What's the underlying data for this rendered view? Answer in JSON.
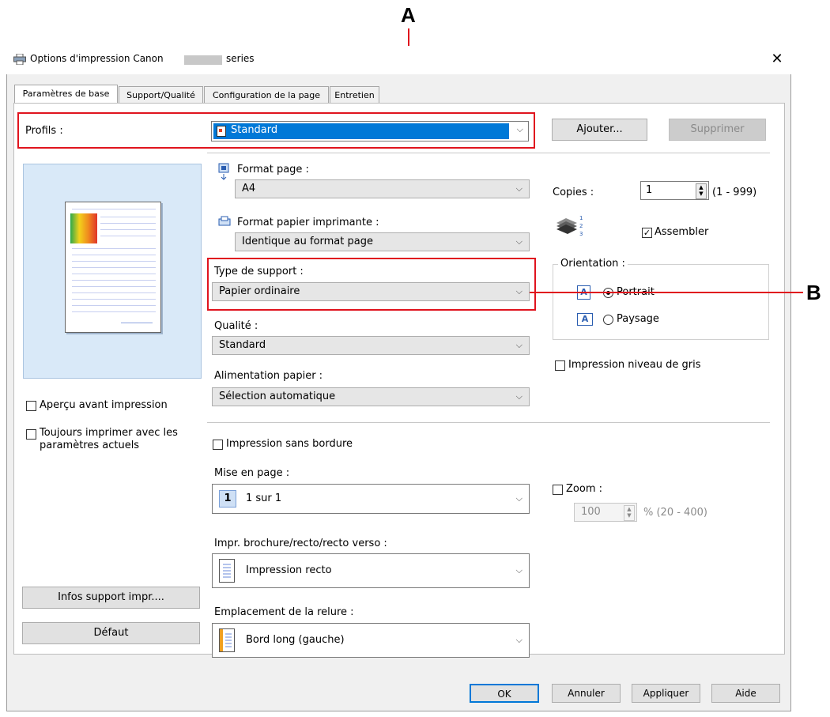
{
  "callouts": {
    "a": "A",
    "b": "B"
  },
  "window": {
    "title": "Options d'impression Canon",
    "title_suffix": "series"
  },
  "tabs": [
    {
      "label": "Paramètres de base"
    },
    {
      "label": "Support/Qualité"
    },
    {
      "label": "Configuration de la page"
    },
    {
      "label": "Entretien"
    }
  ],
  "profiles": {
    "label": "Profils :",
    "value": "Standard",
    "add": "Ajouter...",
    "remove": "Supprimer"
  },
  "page_size": {
    "label": "Format page :",
    "value": "A4"
  },
  "printer_paper": {
    "label": "Format papier imprimante :",
    "value": "Identique au format page"
  },
  "media_type": {
    "label": "Type de support :",
    "value": "Papier ordinaire"
  },
  "quality": {
    "label": "Qualité :",
    "value": "Standard"
  },
  "paper_source": {
    "label": "Alimentation papier :",
    "value": "Sélection automatique"
  },
  "copies": {
    "label": "Copies :",
    "value": "1",
    "range": "(1 - 999)",
    "collate": "Assembler",
    "collate_checked": true
  },
  "orientation": {
    "label": "Orientation :",
    "portrait": "Portrait",
    "landscape": "Paysage",
    "selected": "portrait"
  },
  "grayscale": {
    "label": "Impression niveau de gris"
  },
  "preview_before": {
    "label": "Aperçu avant impression"
  },
  "always_print": {
    "label1": "Toujours imprimer avec les",
    "label2": "paramètres actuels"
  },
  "borderless": {
    "label": "Impression sans bordure"
  },
  "layout": {
    "label": "Mise en page :",
    "badge": "1",
    "value": "1 sur 1"
  },
  "zoom": {
    "label": "Zoom :",
    "value": "100",
    "range": "% (20 - 400)"
  },
  "duplex": {
    "label": "Impr. brochure/recto/recto verso :",
    "value": "Impression recto"
  },
  "binding": {
    "label": "Emplacement de la relure :",
    "value": "Bord long (gauche)"
  },
  "left_buttons": {
    "media_info": "Infos support impr....",
    "defaults": "Défaut"
  },
  "bottom_buttons": {
    "ok": "OK",
    "cancel": "Annuler",
    "apply": "Appliquer",
    "help": "Aide"
  },
  "colors": {
    "callout": "#e0141e",
    "selection": "#0078d7",
    "preview_bg": "#d9e9f8"
  }
}
